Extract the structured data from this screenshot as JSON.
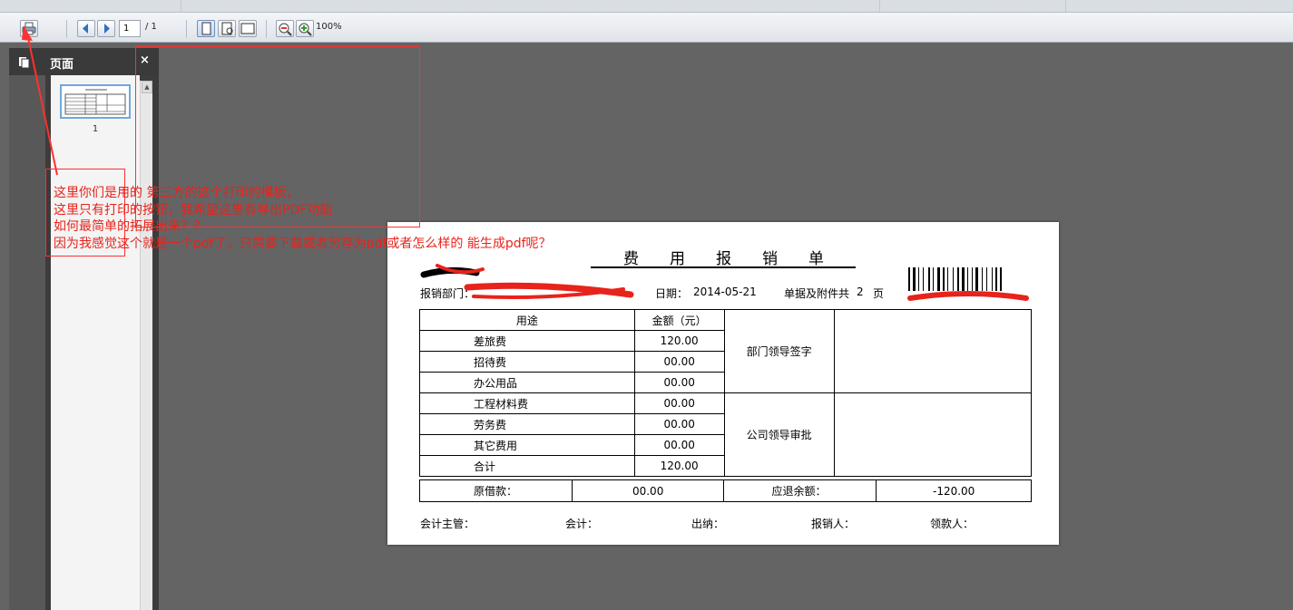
{
  "toolbar": {
    "page_input_value": "1",
    "page_count": "/ 1",
    "zoom": "100%",
    "icons": [
      "print-icon",
      "prev-page-icon",
      "next-page-icon",
      "single-page-view-icon",
      "page-fit-icon",
      "page-width-icon",
      "zoom-out-icon",
      "zoom-in-icon"
    ]
  },
  "sidebar": {
    "title": "页面",
    "close_glyph": "×",
    "thumbnails": [
      {
        "label": "1"
      }
    ]
  },
  "document": {
    "title": "费用报销单",
    "dept_label": "报销部门：",
    "date_label": "日期：",
    "date_value": "2014-05-21",
    "attach_label": "单据及附件共",
    "attach_count": "2",
    "attach_unit": "页",
    "header": {
      "purpose": "用途",
      "amount": "金额（元）"
    },
    "rows": [
      {
        "purpose": "差旅费",
        "amount": "120.00"
      },
      {
        "purpose": "招待费",
        "amount": "00.00"
      },
      {
        "purpose": "办公用品",
        "amount": "00.00"
      },
      {
        "purpose": "工程材料费",
        "amount": "00.00"
      },
      {
        "purpose": "劳务费",
        "amount": "00.00"
      },
      {
        "purpose": "其它费用",
        "amount": "00.00"
      },
      {
        "purpose": "合计",
        "amount": "120.00"
      }
    ],
    "dept_leader": "部门领导签字",
    "company_leader": "公司领导审批",
    "loan_label": "原借款：",
    "loan_value": "00.00",
    "refund_label": "应退余额：",
    "refund_value": "-120.00",
    "signatures": [
      "会计主管：",
      "会计：",
      "出纳：",
      "报销人：",
      "领款人："
    ]
  },
  "annotation": {
    "color": "#e8231b",
    "lines": [
      "这里你们是用的 第三方的这个打印的模板，",
      "这里只有打印的按钮，我希望这里有导出PDF功能",
      "如何最简单的拓展出来？？",
      "因为我感觉这个就是一个pdf了，只需要下载或者另存为pdf或者怎么样的 能生成pdf呢？"
    ]
  }
}
